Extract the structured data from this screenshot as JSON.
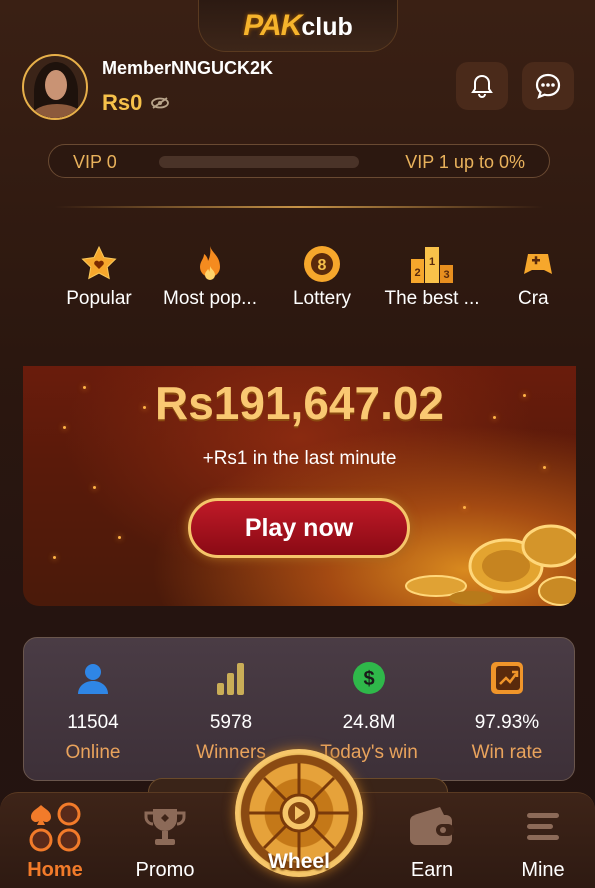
{
  "brand": {
    "logo_pak": "PAK",
    "logo_club": "club"
  },
  "user": {
    "name": "MemberNNGUCK2K",
    "balance": "Rs0"
  },
  "vip": {
    "current": "VIP 0",
    "next": "VIP 1 up to 0%",
    "progress_percent": 0
  },
  "categories": [
    {
      "label": "Popular",
      "icon": "star-heart-icon"
    },
    {
      "label": "Most pop...",
      "icon": "flame-icon"
    },
    {
      "label": "Lottery",
      "icon": "lottery-ball-icon"
    },
    {
      "label": "The best ...",
      "icon": "podium-icon"
    },
    {
      "label": "Cra",
      "icon": "gamepad-icon"
    }
  ],
  "banner": {
    "jackpot": "Rs191,647.02",
    "subtitle": "+Rs1 in the last minute",
    "button": "Play now"
  },
  "stats": [
    {
      "value": "11504",
      "label": "Online",
      "icon": "user-icon"
    },
    {
      "value": "5978",
      "label": "Winners",
      "icon": "bar-chart-icon"
    },
    {
      "value": "24.8M",
      "label": "Today's win",
      "icon": "dollar-icon"
    },
    {
      "value": "97.93%",
      "label": "Win rate",
      "icon": "trend-up-icon"
    }
  ],
  "nav": [
    {
      "label": "Home",
      "icon": "home-icon"
    },
    {
      "label": "Promo",
      "icon": "trophy-icon"
    },
    {
      "label": "Wheel",
      "icon": "wheel-icon"
    },
    {
      "label": "Earn",
      "icon": "wallet-icon"
    },
    {
      "label": "Mine",
      "icon": "menu-icon"
    }
  ],
  "colors": {
    "accent": "#f6b42c",
    "active_nav": "#f27b2a",
    "stat_label": "#e9a35c"
  }
}
